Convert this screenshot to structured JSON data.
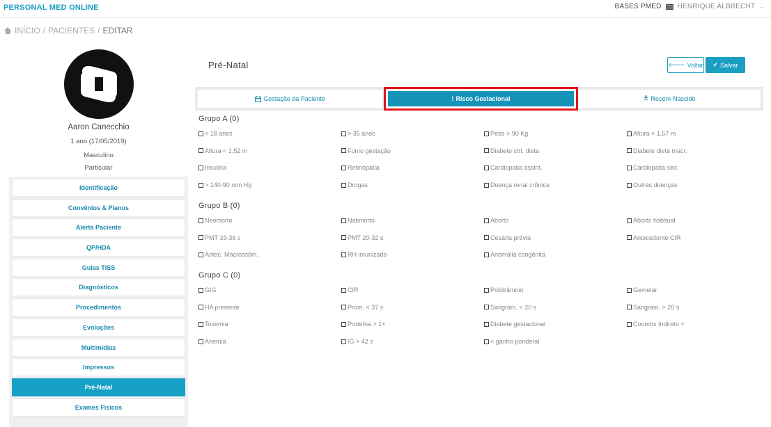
{
  "header": {
    "brand": "PERSONAL MED ONLINE",
    "bases": "BASES PMED",
    "user": "HENRIQUE ALBRECHT",
    "user_caret": "⌄"
  },
  "breadcrumb": {
    "home": "INÍCIO",
    "sep": "/",
    "patients": "PACIENTES",
    "current": "EDITAR"
  },
  "patient": {
    "name": "Aaron Canecchio",
    "age": "1 ano (17/05/2019)",
    "sex": "Masculino",
    "plan": "Particular"
  },
  "sidebar": {
    "items": [
      {
        "label": "Identificação"
      },
      {
        "label": "Convênios & Planos"
      },
      {
        "label": "Alerta Paciente"
      },
      {
        "label": "QP/HDA"
      },
      {
        "label": "Guias TISS"
      },
      {
        "label": "Diagnósticos"
      },
      {
        "label": "Procedimentos"
      },
      {
        "label": "Evoluções"
      },
      {
        "label": "Multimídias"
      },
      {
        "label": "Impressos"
      },
      {
        "label": "Pré-Natal",
        "active": true
      },
      {
        "label": "Exames Físicos"
      }
    ]
  },
  "main": {
    "title": "Pré-Natal",
    "voltar": "Voltar",
    "salvar": "Salvar",
    "tabs": [
      {
        "label": "Gestação da Paciente",
        "icon": "calendar-icon"
      },
      {
        "label": "Risco Gestacional",
        "icon": "exclamation-icon",
        "active": true
      },
      {
        "label": "Recém-Nascido",
        "icon": "child-icon"
      }
    ]
  },
  "groups": [
    {
      "title": "Grupo A (0)",
      "options": [
        "< 18 anos",
        "> 35 anos",
        "Peso > 90 Kg",
        "Altura < 1,57 m",
        "Altura < 1,52 m",
        "Fumo gestação",
        "Diabete ctrl. dieta",
        "Diabete dieta macr.",
        "Insulina",
        "Retinopatia",
        "Cardiopatia assint.",
        "Cardiopatia sint.",
        "> 140-90 mm Hg",
        "Drogas",
        "Doença renal crônica",
        "Outras doenças"
      ]
    },
    {
      "title": "Grupo B (0)",
      "options": [
        "Neomorto",
        "Natimorto",
        "Aborto",
        "Aborto habitual",
        "PMT 33-36 s",
        "PMT 20-32 s",
        "Cesária prévia",
        "Antecedente CIR",
        "Antec. Macrossôm.",
        "RH imunizado",
        "Anomalia congênita"
      ]
    },
    {
      "title": "Grupo C (0)",
      "options": [
        "GIG",
        "CIR",
        "Polidrâmnio",
        "Gemelar",
        "HA presente",
        "Prom. < 37 s",
        "Sangram. < 20 s",
        "Sangram. > 20 s",
        "Toxemia",
        "Proteína > 1+",
        "Diabete gestacional",
        "Coombs Indireto +",
        "Anemia",
        "IG > 42 s",
        "< ganho ponderal"
      ]
    }
  ],
  "colors": {
    "accent": "#1a9fc2",
    "highlight": "#e0161f"
  }
}
